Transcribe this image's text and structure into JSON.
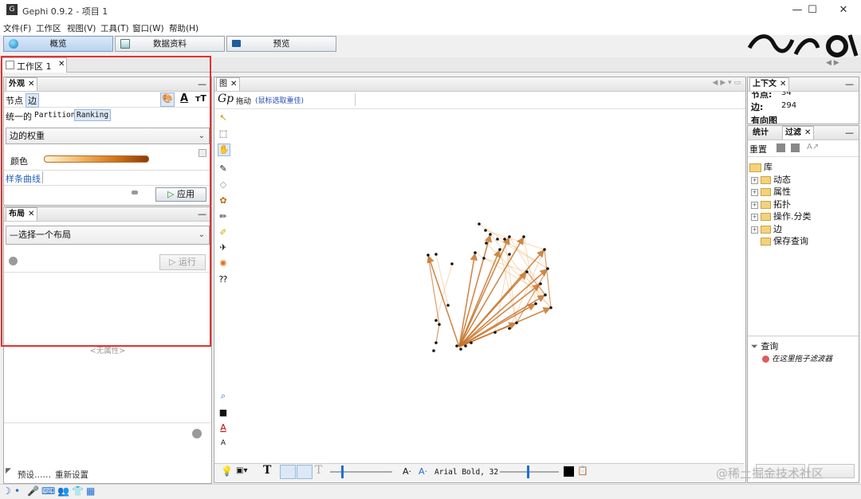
{
  "window": {
    "title": "Gephi 0.9.2 - 项目 1",
    "logo": "G",
    "controls": {
      "minimize": "—",
      "maximize": "☐",
      "close": "✕"
    }
  },
  "menu": [
    "文件(F)",
    "工作区",
    "视图(V)",
    "工具(T)",
    "窗口(W)",
    "帮助(H)"
  ],
  "modes": [
    {
      "label": "概览",
      "icon": "globe-icon",
      "active": true
    },
    {
      "label": "数据资料",
      "icon": "table-icon",
      "active": false
    },
    {
      "label": "预览",
      "icon": "monitor-icon",
      "active": false
    }
  ],
  "workspace_tab": {
    "label": "工作区 1",
    "close": "✕"
  },
  "appearance": {
    "tab_label": "外观",
    "close": "✕",
    "min": "—",
    "element_tabs": [
      "节点",
      "边"
    ],
    "mode_tabs": [
      "统一的",
      "Partition",
      "Ranking"
    ],
    "attribute_select": "边的权重",
    "color_label": "颜色",
    "spline_label": "样条曲线",
    "apply_label": "应用",
    "icons": {
      "palette": "🎨",
      "text_color": "A",
      "text_size": "тT"
    }
  },
  "layout": {
    "tab_label": "布局",
    "close": "✕",
    "min": "—",
    "select": "—选择一个布局",
    "run_label": "运行",
    "no_properties": "<无属性>",
    "presets_label": "预设……",
    "reset_label": "重新设置"
  },
  "graph": {
    "tab_label": "图",
    "close": "✕",
    "mode_text": "拖动",
    "hint_text": "(鼠标选取重佳)",
    "bottom_toolbar": {
      "font": "Arial Bold, 32",
      "font_up": "A·",
      "font_down": "A·"
    },
    "edge_color": "#c8752b",
    "node_color": "#111111"
  },
  "context": {
    "tab_label": "上下文",
    "close": "✕",
    "rows": [
      {
        "label": "节点:",
        "value": "34"
      },
      {
        "label": "边:",
        "value": "294"
      },
      {
        "label": "有向图",
        "value": ""
      }
    ]
  },
  "filters": {
    "tabs": [
      "统计",
      "过滤"
    ],
    "close": "✕",
    "reset_label": "重置",
    "library": {
      "root": "库",
      "items": [
        "动态",
        "属性",
        "拓扑",
        "操作.分类",
        "边",
        "保存查询"
      ]
    },
    "queries_label": "查询",
    "drop_hint": "在这里拖子滤波器"
  },
  "watermark": "@稀土掘金技术社区",
  "annotation_color": "#e53030"
}
